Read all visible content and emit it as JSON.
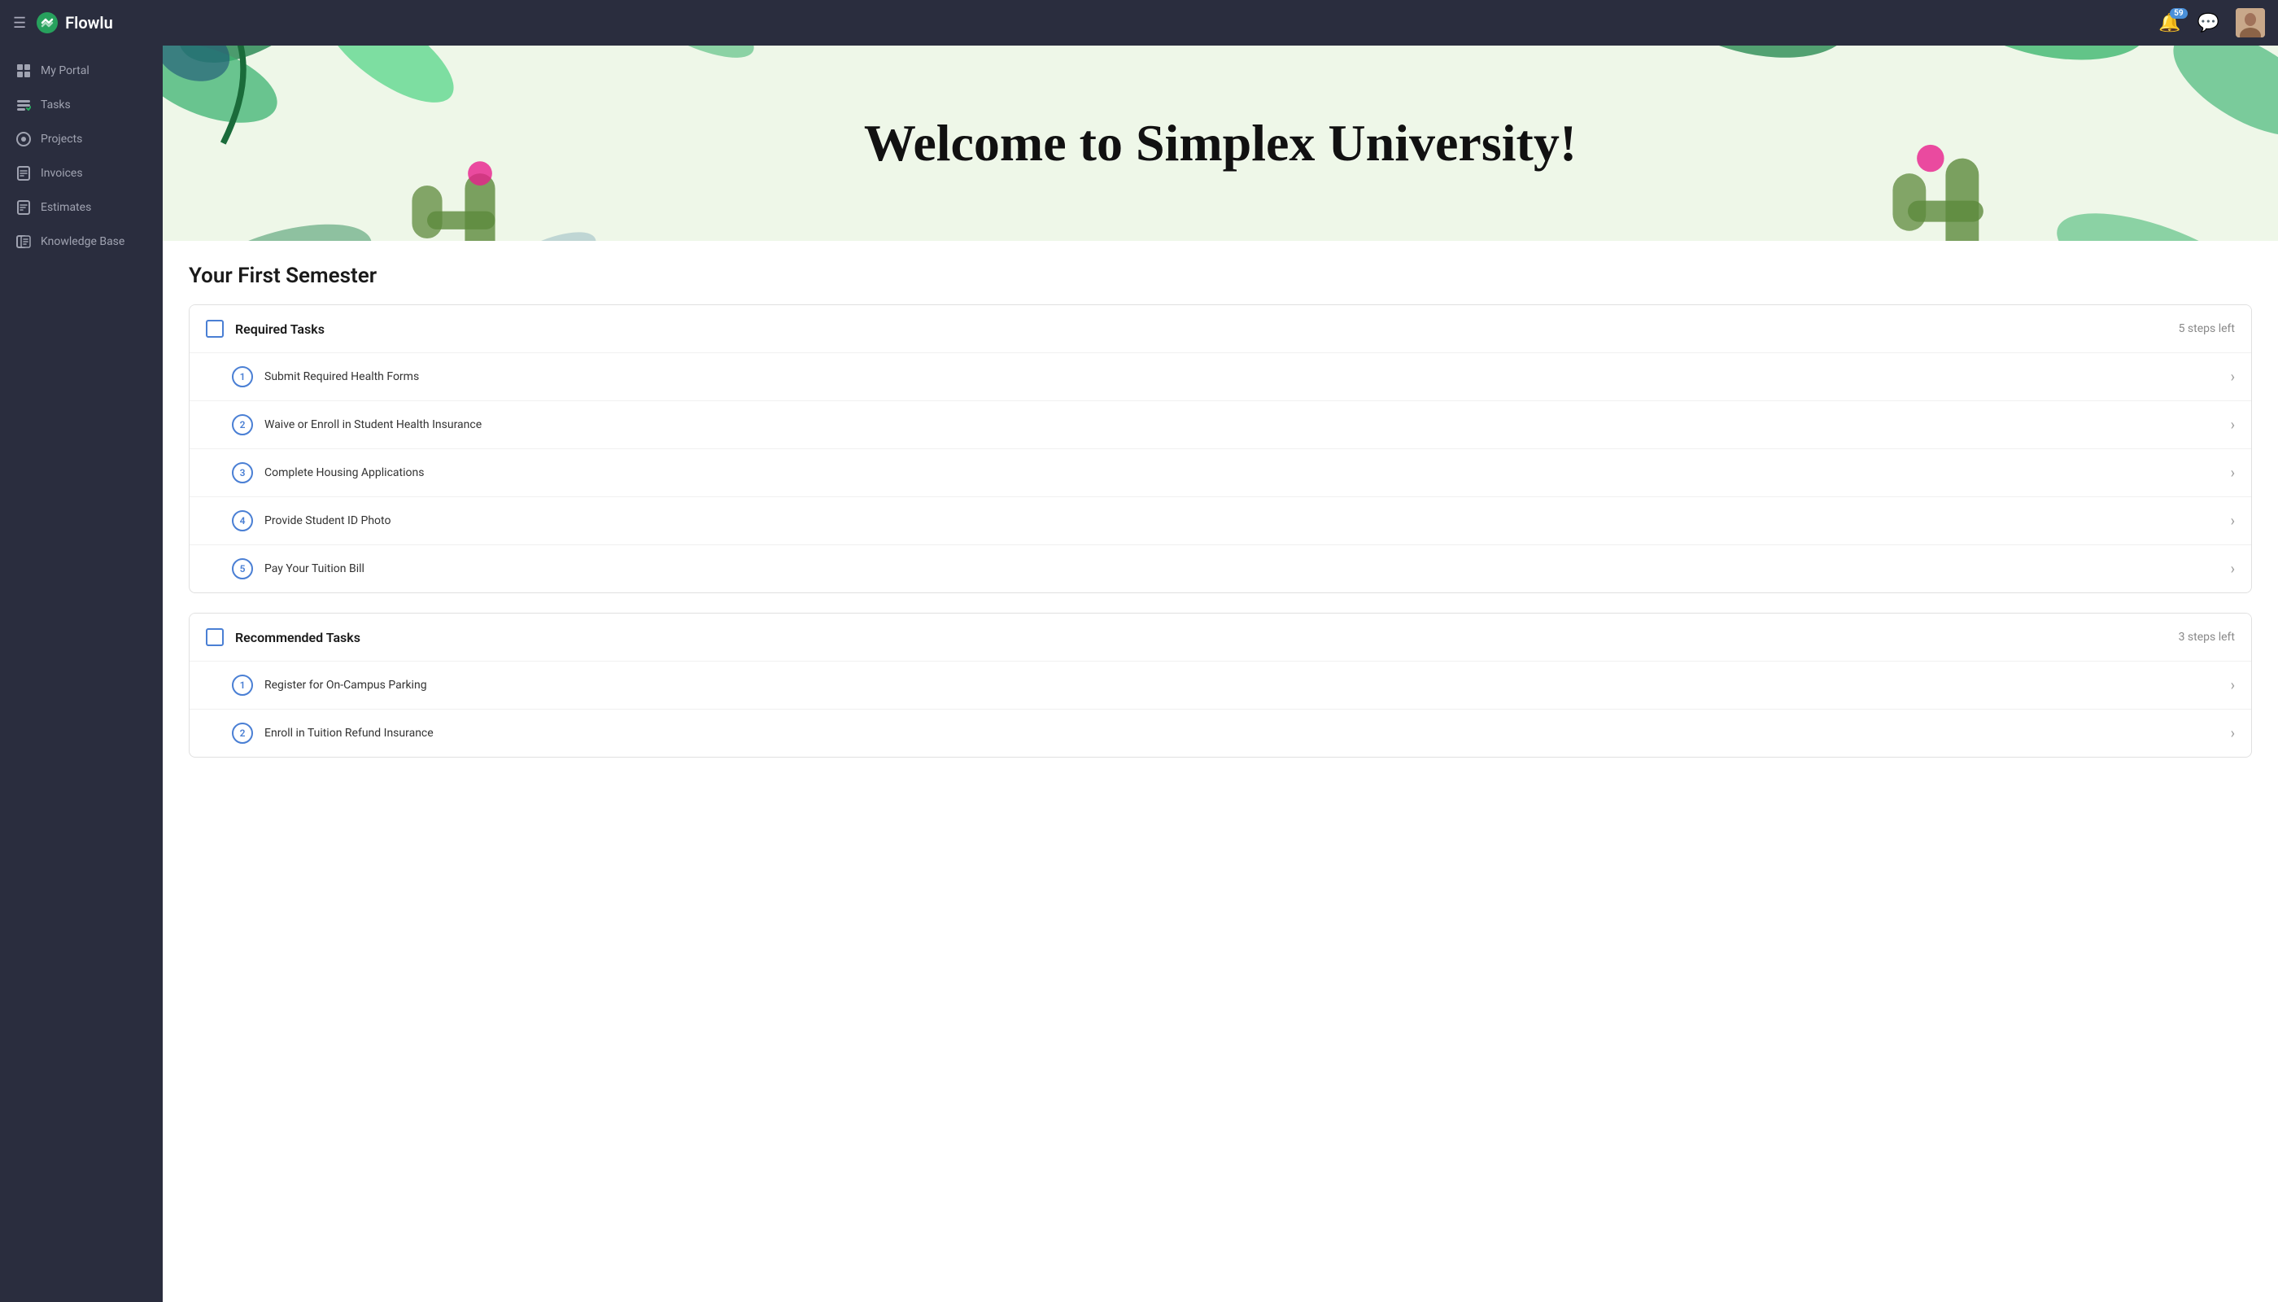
{
  "topbar": {
    "logo_text": "Flowlu",
    "notification_count": "59",
    "hamburger_aria": "menu"
  },
  "sidebar": {
    "items": [
      {
        "id": "my-portal",
        "label": "My Portal",
        "icon": "⊞"
      },
      {
        "id": "tasks",
        "label": "Tasks",
        "icon": "✓"
      },
      {
        "id": "projects",
        "label": "Projects",
        "icon": "◎"
      },
      {
        "id": "invoices",
        "label": "Invoices",
        "icon": "🗒"
      },
      {
        "id": "estimates",
        "label": "Estimates",
        "icon": "📋"
      },
      {
        "id": "knowledge-base",
        "label": "Knowledge Base",
        "icon": "📚"
      }
    ]
  },
  "banner": {
    "title": "Welcome to Simplex University!"
  },
  "main": {
    "section_title": "Your First Semester",
    "task_groups": [
      {
        "id": "required",
        "label": "Required Tasks",
        "steps_left": "5 steps left",
        "items": [
          {
            "number": "1",
            "label": "Submit Required Health Forms"
          },
          {
            "number": "2",
            "label": "Waive or Enroll in Student Health Insurance"
          },
          {
            "number": "3",
            "label": "Complete Housing Applications"
          },
          {
            "number": "4",
            "label": "Provide Student ID Photo"
          },
          {
            "number": "5",
            "label": "Pay Your Tuition Bill"
          }
        ]
      },
      {
        "id": "recommended",
        "label": "Recommended Tasks",
        "steps_left": "3 steps left",
        "items": [
          {
            "number": "1",
            "label": "Register for On-Campus Parking"
          },
          {
            "number": "2",
            "label": "Enroll in Tuition Refund Insurance"
          }
        ]
      }
    ]
  }
}
